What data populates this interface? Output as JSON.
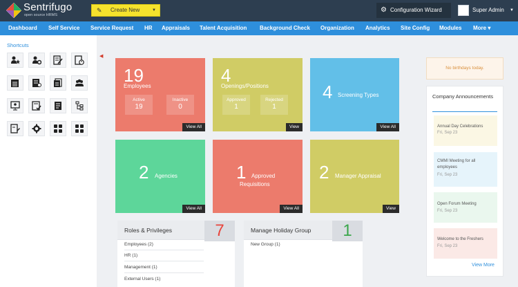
{
  "header": {
    "logo_text": "Sentrifugo",
    "logo_sub": "open source HRMS",
    "create_label": "Create New",
    "config_label": "Configuration Wizard",
    "user_label": "Super Admin"
  },
  "nav": {
    "items": [
      "Dashboard",
      "Self Service",
      "Service Request",
      "HR",
      "Appraisals",
      "Talent Acquisition",
      "Background Check",
      "Organization",
      "Analytics",
      "Site Config",
      "Modules",
      "More ▾"
    ]
  },
  "sidebar": {
    "title": "Shortcuts",
    "icons": [
      "user-star-icon",
      "users-gear-icon",
      "document-edit-icon",
      "schedule-icon",
      "calendar-list-icon",
      "document-person-icon",
      "documents-icon",
      "group-icon",
      "monitor-user-icon",
      "checklist-icon",
      "report-icon",
      "org-tree-icon",
      "document-pen-icon",
      "gear-icon",
      "grid-icon",
      "grid-icon"
    ]
  },
  "tiles": {
    "employees": {
      "count": "19",
      "title": "Employees",
      "active_label": "Active",
      "active_value": "19",
      "inactive_label": "Inactive",
      "inactive_value": "0",
      "link": "View All"
    },
    "openings": {
      "count": "4",
      "title": "Openings/Positions",
      "approved_label": "Approved",
      "approved_value": "1",
      "rejected_label": "Rejected",
      "rejected_value": "1",
      "link": "View"
    },
    "screening": {
      "count": "4",
      "title": "Screening Types",
      "link": "View All"
    },
    "agencies": {
      "count": "2",
      "title": "Agencies",
      "link": "View All"
    },
    "requisitions": {
      "count": "1",
      "title_line1": "Approved",
      "title_line2": "Requisitions",
      "link": "View All"
    },
    "appraisal": {
      "count": "2",
      "title": "Manager Appraisal",
      "link": "View"
    }
  },
  "roles_panel": {
    "title": "Roles & Privileges",
    "count": "7",
    "items": [
      "Employees (2)",
      "HR (1)",
      "Management (1)",
      "External Users (1)"
    ]
  },
  "holiday_panel": {
    "title": "Manage Holiday Group",
    "count": "1",
    "items": [
      "New Group (1)"
    ]
  },
  "right": {
    "birthday": "No birthdays today.",
    "ann_title": "Company Announcements",
    "announcements": [
      {
        "title": "Annual Day Celebrations",
        "date": "Fri, Sep 23"
      },
      {
        "title": "CMMI Meeting for all employees",
        "date": "Fri, Sep 23"
      },
      {
        "title": "Open Forum Meeting",
        "date": "Fri, Sep 23"
      },
      {
        "title": "Welcome to the Freshers",
        "date": "Fri, Sep 23"
      }
    ],
    "view_more": "View More"
  },
  "colors": {
    "header_bg": "#2d3e50",
    "nav_bg": "#2e8fdc",
    "salmon": "#ec7b6c",
    "olive": "#d0cc65",
    "sky": "#62bfe8",
    "green": "#5dd69a",
    "count_red": "#e8453c",
    "count_green": "#3aa64a"
  }
}
